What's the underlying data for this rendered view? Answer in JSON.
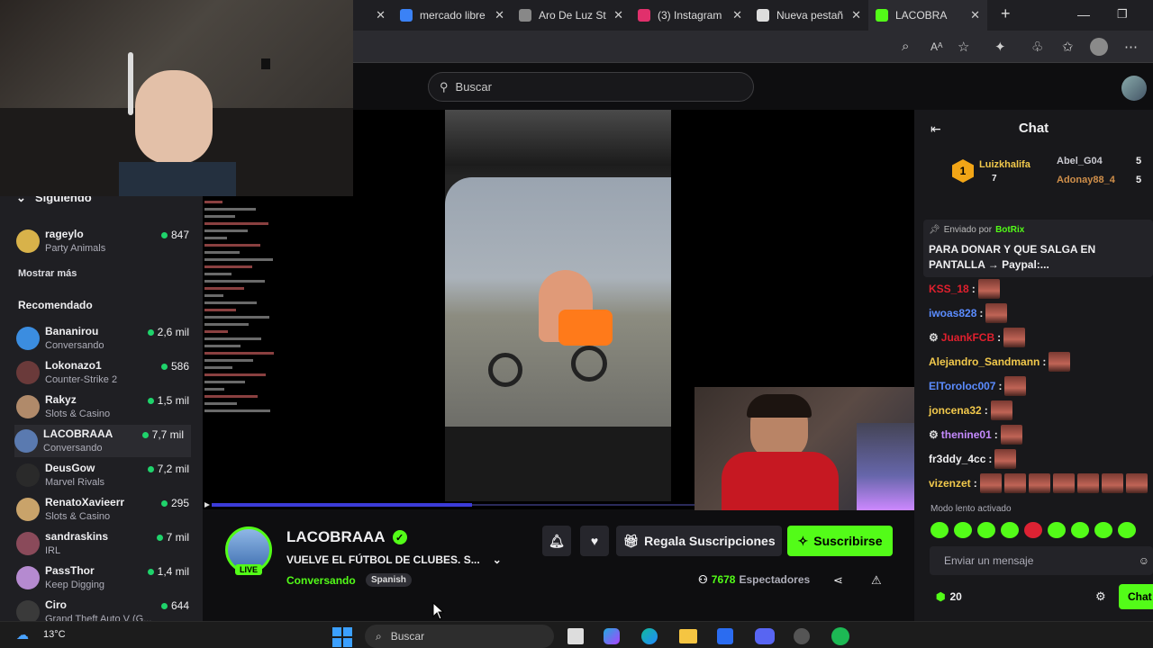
{
  "browser": {
    "tabs": [
      {
        "label": "",
        "fav": "#333"
      },
      {
        "label": "mercado libre",
        "fav": "#3b82f6"
      },
      {
        "label": "Aro De Luz Str",
        "fav": "#888"
      },
      {
        "label": "(3) Instagram",
        "fav": "#e1306c"
      },
      {
        "label": "Nueva pestañ",
        "fav": "#ddd"
      },
      {
        "label": "LACOBRA",
        "fav": "#53fc18",
        "active": true
      }
    ]
  },
  "search": {
    "placeholder": "Buscar"
  },
  "sidebar": {
    "following_header": "Siguiendo",
    "following": [
      {
        "name": "rageylo",
        "game": "Party Animals",
        "viewers": "847",
        "color": "#d8b24a"
      }
    ],
    "show_more": "Mostrar más",
    "recommended_header": "Recomendado",
    "recommended": [
      {
        "name": "Bananirou",
        "game": "Conversando",
        "viewers": "2,6 mil",
        "color": "#3b8de0"
      },
      {
        "name": "Lokonazo1",
        "game": "Counter-Strike 2",
        "viewers": "586",
        "color": "#6a3a3a"
      },
      {
        "name": "Rakyz",
        "game": "Slots & Casino",
        "viewers": "1,5 mil",
        "color": "#b08a6a"
      },
      {
        "name": "LACOBRAAA",
        "game": "Conversando",
        "viewers": "7,7 mil",
        "color": "#5a7ab0"
      },
      {
        "name": "DeusGow",
        "game": "Marvel Rivals",
        "viewers": "7,2 mil",
        "color": "#2a2a2a"
      },
      {
        "name": "RenatoXavieerr",
        "game": "Slots & Casino",
        "viewers": "295",
        "color": "#c9a36a"
      },
      {
        "name": "sandraskins",
        "game": "IRL",
        "viewers": "7 mil",
        "color": "#8a4a5a"
      },
      {
        "name": "PassThor",
        "game": "Keep Digging",
        "viewers": "1,4 mil",
        "color": "#b58ad0"
      },
      {
        "name": "Ciro",
        "game": "Grand Theft Auto V (G...",
        "viewers": "644",
        "color": "#3a3a3a"
      }
    ]
  },
  "stream": {
    "channel": "LACOBRAAA",
    "live_badge": "LIVE",
    "title": "VUELVE EL FÚTBOL DE CLUBES. S...",
    "category": "Conversando",
    "tag": "Spanish",
    "gift_button": "Regala Suscripciones",
    "subscribe_button": "Suscribirse",
    "viewers_count": "7678",
    "viewers_label": "Espectadores",
    "progress": 0.98
  },
  "chat": {
    "header": "Chat",
    "top": {
      "first": "Luizkhalifa",
      "first_count": "7",
      "second": "Abel_G04",
      "second_count": "5",
      "third": "Adonay88_4",
      "third_count": "5",
      "rank": "1"
    },
    "pinned_label": "Enviado por",
    "pinned_by": "BotRix",
    "pinned_text": "PARA DONAR Y QUE SALGA EN PANTALLA → Paypal:...",
    "messages": [
      {
        "user": "KSS_18",
        "color": "#e0202e",
        "emotes": 1
      },
      {
        "user": "iwoas828",
        "color": "#5b8cff",
        "emotes": 1
      },
      {
        "user": "JuankFCB",
        "color": "#e0202e",
        "emotes": 1,
        "badge": true
      },
      {
        "user": "Alejandro_Sandmann",
        "color": "#f2c94c",
        "emotes": 1
      },
      {
        "user": "ElToroloc007",
        "color": "#5b8cff",
        "emotes": 1
      },
      {
        "user": "joncena32",
        "color": "#f2c94c",
        "emotes": 1
      },
      {
        "user": "thenine01",
        "color": "#c58aff",
        "emotes": 1,
        "badge": true
      },
      {
        "user": "fr3ddy_4cc",
        "color": "#efeff1",
        "emotes": 1
      },
      {
        "user": "vizenzet",
        "color": "#f2c94c",
        "emotes": 7
      }
    ],
    "slow_mode": "Modo lento activado",
    "input_placeholder": "Enviar un mensaje",
    "points": "20",
    "send_button": "Chat"
  },
  "taskbar": {
    "weather": "13°C",
    "search": "Buscar"
  }
}
